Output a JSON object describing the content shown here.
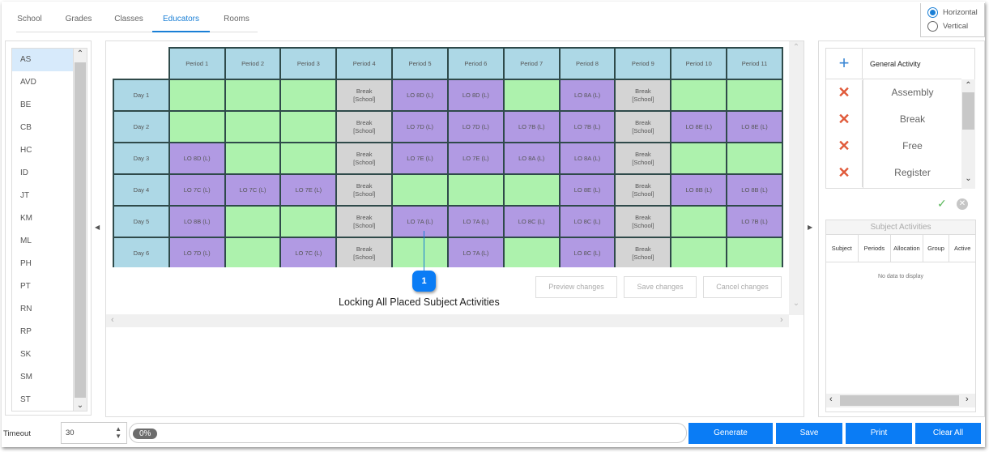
{
  "tabs": [
    {
      "label": "School",
      "active": false
    },
    {
      "label": "Grades",
      "active": false
    },
    {
      "label": "Classes",
      "active": false
    },
    {
      "label": "Educators",
      "active": true
    },
    {
      "label": "Rooms",
      "active": false
    }
  ],
  "orientation": {
    "options": [
      "Horizontal",
      "Vertical"
    ],
    "selected": "Horizontal"
  },
  "educators": {
    "items": [
      "AS",
      "AVD",
      "BE",
      "CB",
      "HC",
      "ID",
      "JT",
      "KM",
      "ML",
      "PH",
      "PT",
      "RN",
      "RP",
      "SK",
      "SM",
      "ST"
    ],
    "selected": "AS"
  },
  "timetable": {
    "periods": [
      "Period 1",
      "Period 2",
      "Period 3",
      "Period 4",
      "Period 5",
      "Period 6",
      "Period 7",
      "Period 8",
      "Period 9",
      "Period 10",
      "Period 11"
    ],
    "days": [
      {
        "label": "Day 1",
        "cells": [
          "",
          "",
          "",
          "Break\n[School]",
          "LO 8D (L)",
          "LO 8D (L)",
          "",
          "LO 8A (L)",
          "Break\n[School]",
          "",
          ""
        ]
      },
      {
        "label": "Day 2",
        "cells": [
          "",
          "",
          "",
          "Break\n[School]",
          "LO 7D (L)",
          "LO 7D (L)",
          "LO 7B (L)",
          "LO 7B (L)",
          "Break\n[School]",
          "LO 8E (L)",
          "LO 8E (L)"
        ]
      },
      {
        "label": "Day 3",
        "cells": [
          "LO 8D (L)",
          "",
          "",
          "Break\n[School]",
          "LO 7E (L)",
          "LO 7E (L)",
          "LO 8A (L)",
          "LO 8A (L)",
          "Break\n[School]",
          "",
          ""
        ]
      },
      {
        "label": "Day 4",
        "cells": [
          "LO 7C (L)",
          "LO 7C (L)",
          "LO 7E (L)",
          "Break\n[School]",
          "",
          "",
          "",
          "LO 8E (L)",
          "Break\n[School]",
          "LO 8B (L)",
          "LO 8B (L)"
        ]
      },
      {
        "label": "Day 5",
        "cells": [
          "LO 8B (L)",
          "",
          "",
          "Break\n[School]",
          "LO 7A (L)",
          "LO 7A (L)",
          "LO 8C (L)",
          "LO 8C (L)",
          "Break\n[School]",
          "",
          "LO 7B (L)"
        ]
      },
      {
        "label": "Day 6",
        "cells": [
          "LO 7D (L)",
          "",
          "LO 7C (L)",
          "Break\n[School]",
          "",
          "LO 7A (L)",
          "",
          "LO 8C (L)",
          "Break\n[School]",
          "",
          ""
        ]
      }
    ]
  },
  "colors": {
    "header": "#add8e6",
    "free": "#adf2ad",
    "lesson": "#b19ae3",
    "break": "#d4d4d4",
    "accent": "#0a7cf5"
  },
  "change_buttons": {
    "preview": "Preview changes",
    "save": "Save changes",
    "cancel": "Cancel changes"
  },
  "callout": {
    "number": "1",
    "text": "Locking All Placed Subject Activities"
  },
  "general_activity": {
    "title": "General Activity",
    "items": [
      "Assembly",
      "Break",
      "Free",
      "Register"
    ]
  },
  "subject_activities": {
    "title": "Subject Activities",
    "columns": [
      "Subject",
      "Periods",
      "Allocation",
      "Group",
      "Active"
    ],
    "empty_text": "No data to display"
  },
  "bottom": {
    "timeout_label": "Timeout",
    "timeout_value": "30",
    "progress_percent": 0,
    "progress_text": "0%",
    "buttons": [
      "Generate",
      "Save",
      "Print",
      "Clear All"
    ]
  }
}
